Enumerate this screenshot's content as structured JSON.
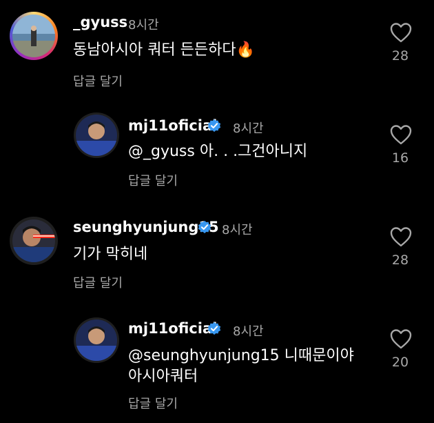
{
  "comments": [
    {
      "username": "_gyuss",
      "time": "8시간",
      "text": "동남아시아 쿼터 든든하다",
      "emoji": "🔥",
      "reply_label": "답글 달기",
      "likes": "28",
      "verified": false
    },
    {
      "username": "mj11oficial",
      "time": "8시간",
      "mention": "@_gyuss",
      "text": " 아. . .그건아니지",
      "reply_label": "답글 달기",
      "likes": "16",
      "verified": true
    },
    {
      "username": "seunghyunjung15",
      "time": "8시간",
      "text": "기가 막히네",
      "reply_label": "답글 달기",
      "likes": "28",
      "verified": true
    },
    {
      "username": "mj11oficial",
      "time": "8시간",
      "mention": "@seunghyunjung15",
      "text": " 니때문이야",
      "text_line2": "아시아쿼터",
      "reply_label": "답글 달기",
      "likes": "20",
      "verified": true
    }
  ],
  "colors": {
    "background": "#000000",
    "secondary_text": "#a8a8a8",
    "verified_blue": "#3897f0"
  },
  "icons": [
    "heart-outline-icon",
    "verified-badge-icon"
  ]
}
